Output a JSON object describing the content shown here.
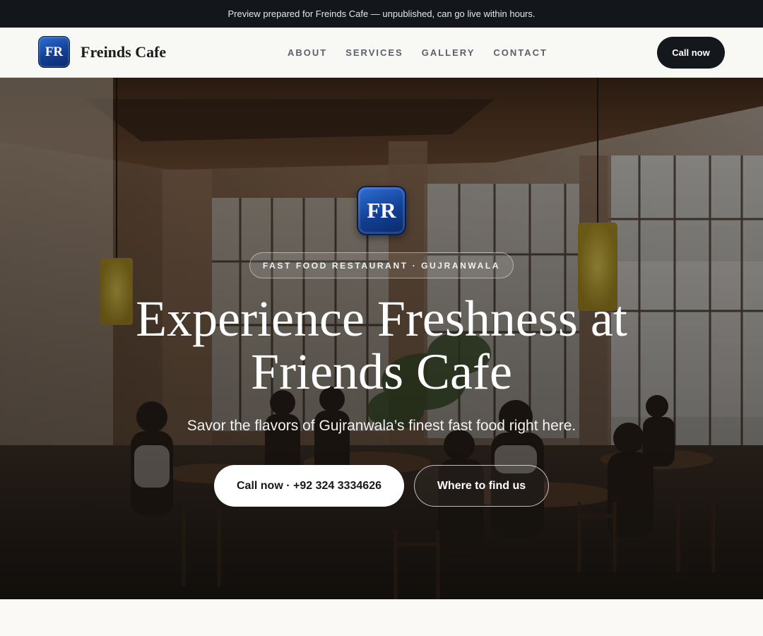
{
  "banner": {
    "text": "Preview prepared for Freinds Cafe — unpublished, can go live within hours."
  },
  "nav": {
    "logo_initials": "FR",
    "brand_name": "Freinds Cafe",
    "items": [
      {
        "label": "ABOUT"
      },
      {
        "label": "SERVICES"
      },
      {
        "label": "GALLERY"
      },
      {
        "label": "CONTACT"
      }
    ],
    "cta_label": "Call now"
  },
  "hero": {
    "logo_initials": "FR",
    "tagline": "FAST FOOD RESTAURANT · GUJRANWALA",
    "headline_line1": "Experience Freshness at",
    "headline_line2": "Friends Cafe",
    "subheadline": "Savor the flavors of Gujranwala’s finest fast food right here.",
    "primary_cta": "Call now · +92 324 3334626",
    "secondary_cta": "Where to find us",
    "background_image": "restaurant-interior-photo"
  },
  "colors": {
    "banner_bg": "#13161b",
    "nav_bg": "#f8f8f5",
    "accent_dark": "#14171c",
    "logo_blue": "#123f93"
  }
}
